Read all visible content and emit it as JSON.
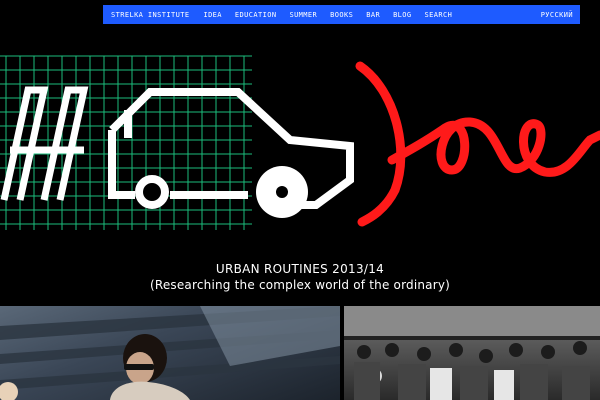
{
  "nav": {
    "brand": "STRELKA INSTITUTE",
    "items": [
      "IDEA",
      "EDUCATION",
      "SUMMER",
      "BOOKS",
      "BAR",
      "BLOG",
      "SEARCH"
    ],
    "language": "РУССКИЙ"
  },
  "hero": {
    "title": "URBAN ROUTINES 2013/14",
    "subtitle": "(Researching the complex world of the ordinary)"
  },
  "colors": {
    "nav_background": "#1e5bff",
    "grid": "#1fd28a",
    "accent": "#ff1a1a",
    "background": "#000000"
  }
}
